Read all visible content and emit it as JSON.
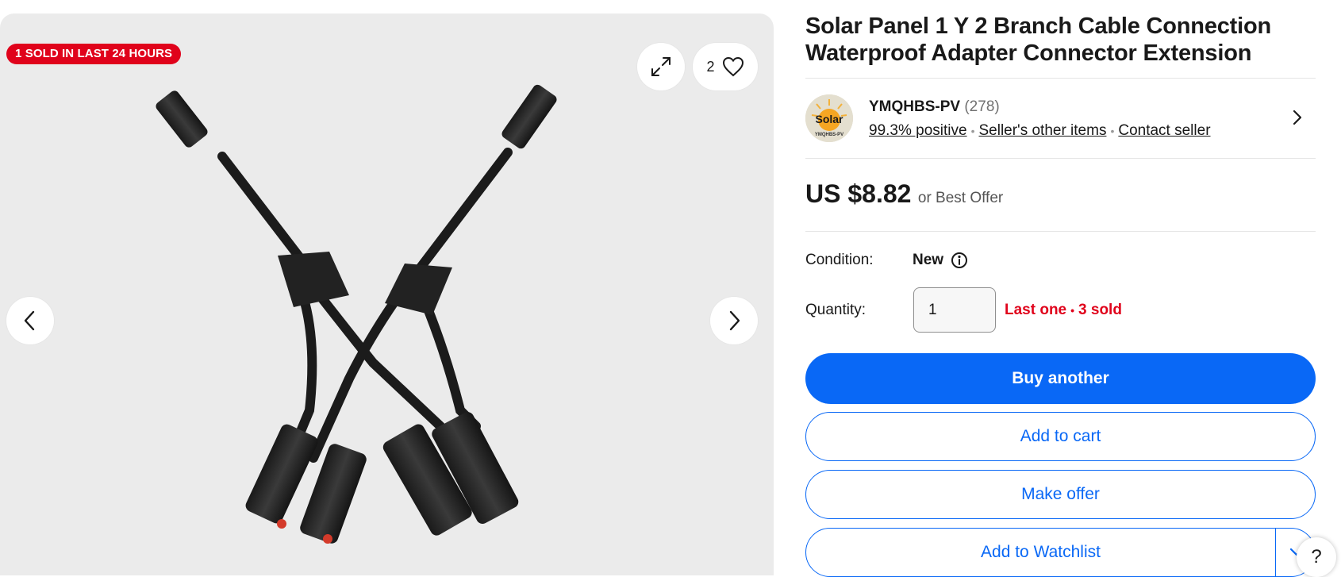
{
  "gallery": {
    "sold_badge": "1 SOLD IN LAST 24 HOURS",
    "like_count": "2",
    "icons": {
      "expand": "expand-icon",
      "like": "heart-icon",
      "prev": "chevron-left-icon",
      "next": "chevron-right-icon"
    }
  },
  "listing": {
    "title": "Solar Panel 1 Y 2 Branch Cable Connection Waterproof Adapter Connector Extension"
  },
  "seller": {
    "name": "YMQHBS-PV",
    "count": "(278)",
    "feedback": "99.3% positive",
    "other_items": "Seller's other items",
    "contact": "Contact seller",
    "avatar_text": "Solar",
    "avatar_subtext": "YMQHBS-PV"
  },
  "price": {
    "amount": "US $8.82",
    "offer_text": "or Best Offer"
  },
  "condition": {
    "label": "Condition:",
    "value": "New"
  },
  "quantity": {
    "label": "Quantity:",
    "value": "1",
    "status_last": "Last one",
    "status_sold": "3 sold"
  },
  "actions": {
    "buy": "Buy another",
    "cart": "Add to cart",
    "offer": "Make offer",
    "watchlist": "Add to Watchlist"
  },
  "help": {
    "label": "?"
  },
  "colors": {
    "accent": "#0968f6",
    "badge_red": "#e0021b",
    "gallery_bg": "#ebebeb"
  }
}
